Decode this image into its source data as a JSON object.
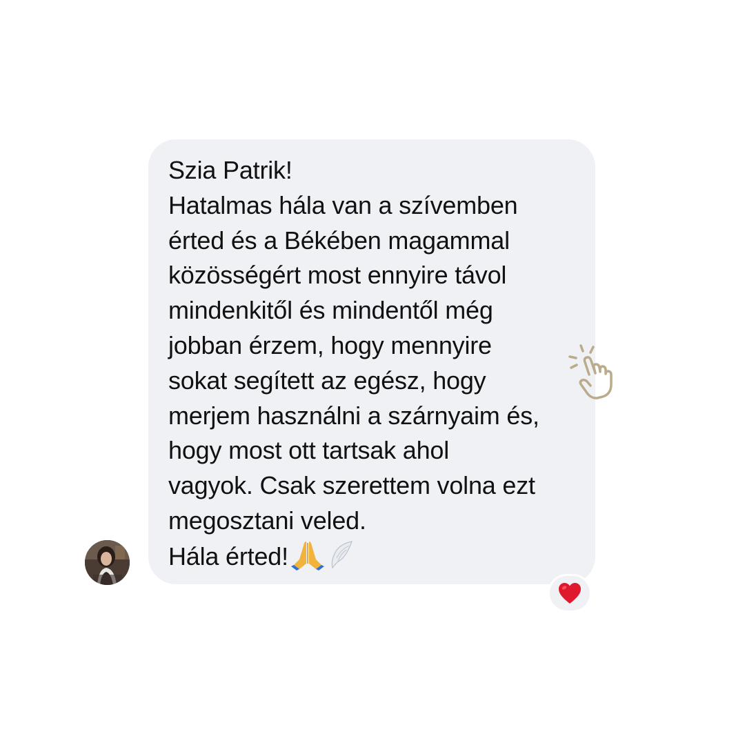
{
  "message": {
    "lines": [
      "Szia Patrik!",
      "Hatalmas hála van a szívemben",
      "érted és a Békében magammal",
      "közösségért most ennyire távol",
      "mindenkitől és mindentől még",
      "jobban érzem, hogy mennyire",
      "sokat segített az egész, hogy",
      "merjem használni a szárnyaim és,",
      "hogy most ott tartsak ahol",
      "vagyok. Csak szerettem volna ezt",
      "megosztani veled."
    ],
    "last_line": "Hála érted!",
    "emojis": [
      "praying-hands-emoji",
      "wing-emoji"
    ]
  },
  "reaction": {
    "icon": "heart-icon",
    "color": "#e0182d"
  },
  "sender": {
    "avatar": "profile-photo"
  },
  "decoration": {
    "icon": "tap-hand-icon",
    "color": "#b9ab8c"
  },
  "colors": {
    "background": "#ffffff",
    "bubble": "#f0f1f5",
    "text": "#111111"
  }
}
